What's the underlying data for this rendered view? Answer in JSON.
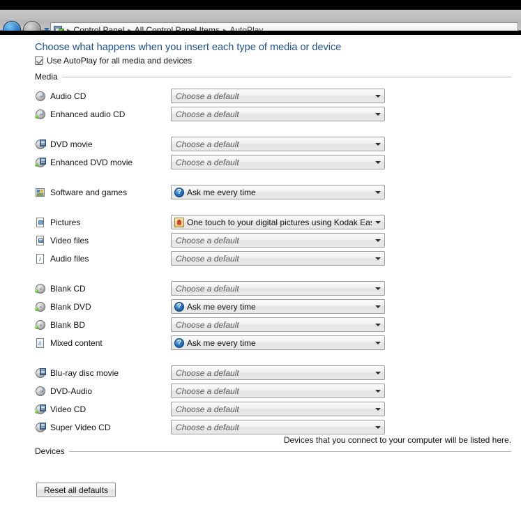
{
  "window": {
    "nav": {
      "back_label": "Back",
      "forward_label": "Forward",
      "recent_pages_label": "Recent pages"
    },
    "breadcrumb": {
      "icon": "control-panel-icon",
      "items": [
        "Control Panel",
        "All Control Panel Items",
        "AutoPlay"
      ],
      "separator": "▸"
    }
  },
  "page": {
    "title": "Choose what happens when you insert each type of media or device",
    "use_autoplay": {
      "label": "Use AutoPlay for all media and devices",
      "checked": true
    },
    "accent_color": "#1c4f8c"
  },
  "groups": {
    "media": {
      "label": "Media"
    },
    "devices": {
      "label": "Devices",
      "empty_note": "Devices that you connect to your computer will be listed here."
    }
  },
  "defaults": {
    "placeholder": "Choose a default",
    "ask_me": "Ask me every time",
    "kodak": "One touch to your digital pictures using Kodak EasyShare s"
  },
  "media_rows": [
    {
      "label": "Audio CD",
      "icon": "audio-cd-icon",
      "value": "Choose a default",
      "state": "placeholder",
      "value_icon": "none"
    },
    {
      "label": "Enhanced audio CD",
      "icon": "enhanced-audio-cd-icon",
      "value": "Choose a default",
      "state": "placeholder",
      "value_icon": "none"
    },
    {
      "label": "DVD movie",
      "icon": "dvd-movie-icon",
      "value": "Choose a default",
      "state": "placeholder",
      "value_icon": "none"
    },
    {
      "label": "Enhanced DVD movie",
      "icon": "enhanced-dvd-movie-icon",
      "value": "Choose a default",
      "state": "placeholder",
      "value_icon": "none"
    },
    {
      "label": "Software and games",
      "icon": "software-and-games-icon",
      "value": "Ask me every time",
      "state": "selected",
      "value_icon": "ask-icon"
    },
    {
      "label": "Pictures",
      "icon": "pictures-icon",
      "value": "One touch to your digital pictures using Kodak EasyShare s",
      "state": "selected",
      "value_icon": "kodak-icon"
    },
    {
      "label": "Video files",
      "icon": "video-files-icon",
      "value": "Choose a default",
      "state": "placeholder",
      "value_icon": "none"
    },
    {
      "label": "Audio files",
      "icon": "audio-files-icon",
      "value": "Choose a default",
      "state": "placeholder",
      "value_icon": "none"
    },
    {
      "label": "Blank CD",
      "icon": "blank-cd-icon",
      "value": "Choose a default",
      "state": "placeholder",
      "value_icon": "none"
    },
    {
      "label": "Blank DVD",
      "icon": "blank-dvd-icon",
      "value": "Ask me every time",
      "state": "selected",
      "value_icon": "ask-icon"
    },
    {
      "label": "Blank BD",
      "icon": "blank-bd-icon",
      "value": "Choose a default",
      "state": "placeholder",
      "value_icon": "none"
    },
    {
      "label": "Mixed content",
      "icon": "mixed-content-icon",
      "value": "Ask me every time",
      "state": "selected",
      "value_icon": "ask-icon"
    },
    {
      "label": "Blu-ray disc movie",
      "icon": "bluray-disc-movie-icon",
      "value": "Choose a default",
      "state": "placeholder",
      "value_icon": "none"
    },
    {
      "label": "DVD-Audio",
      "icon": "dvd-audio-icon",
      "value": "Choose a default",
      "state": "placeholder",
      "value_icon": "none"
    },
    {
      "label": "Video CD",
      "icon": "video-cd-icon",
      "value": "Choose a default",
      "state": "placeholder",
      "value_icon": "none"
    },
    {
      "label": "Super Video CD",
      "icon": "super-video-cd-icon",
      "value": "Choose a default",
      "state": "placeholder",
      "value_icon": "none"
    }
  ],
  "buttons": {
    "reset_all_defaults": "Reset all defaults"
  }
}
